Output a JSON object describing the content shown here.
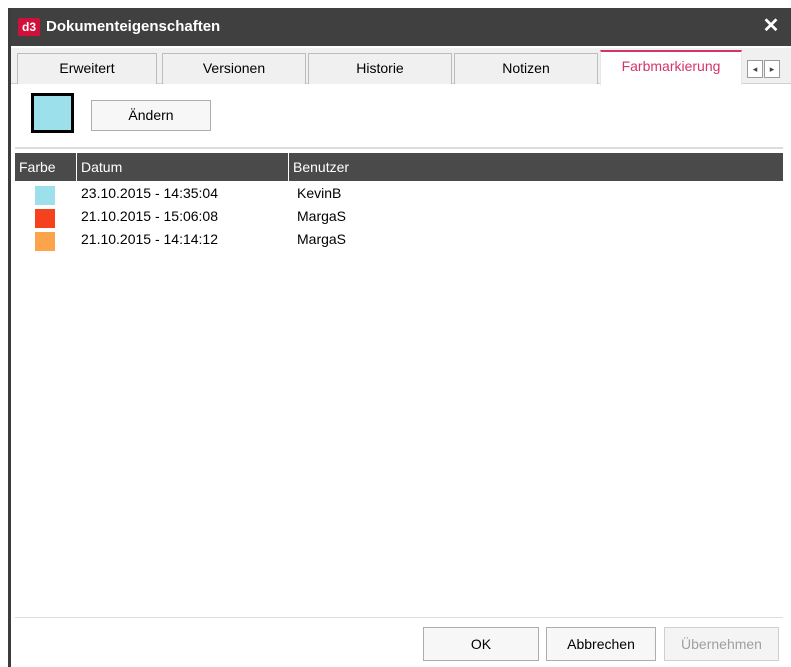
{
  "window": {
    "app_logo": "d3",
    "title": "Dokumenteigenschaften",
    "close_icon": "close-icon"
  },
  "tabs": [
    {
      "label": "Erweitert",
      "active": false
    },
    {
      "label": "Versionen",
      "active": false
    },
    {
      "label": "Historie",
      "active": false
    },
    {
      "label": "Notizen",
      "active": false
    },
    {
      "label": "Farbmarkierung",
      "active": true
    }
  ],
  "tab_scroll": {
    "left": "◂",
    "right": "▸"
  },
  "current_color": "#9be0ea",
  "change_button": "Ändern",
  "table": {
    "columns": [
      "Farbe",
      "Datum",
      "Benutzer"
    ],
    "rows": [
      {
        "color": "#9be0ea",
        "date": "23.10.2015 - 14:35:04",
        "user": "KevinB"
      },
      {
        "color": "#f5411d",
        "date": "21.10.2015 - 15:06:08",
        "user": "MargaS"
      },
      {
        "color": "#fca44b",
        "date": "21.10.2015 - 14:14:12",
        "user": "MargaS"
      }
    ]
  },
  "buttons": {
    "ok": "OK",
    "cancel": "Abbrechen",
    "apply": "Übernehmen"
  }
}
